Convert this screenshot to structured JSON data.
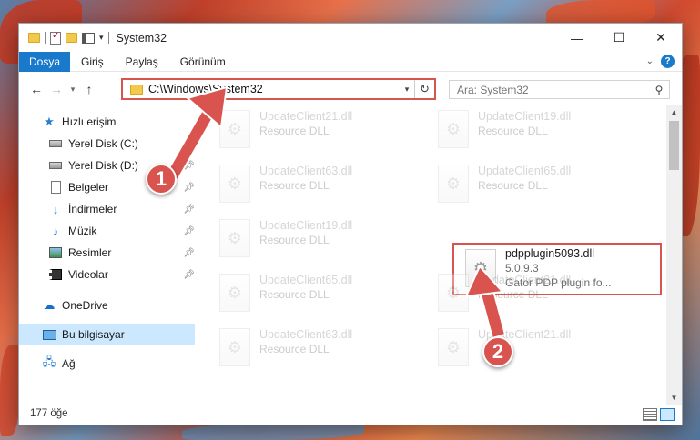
{
  "window": {
    "title": "System32",
    "controls": {
      "minimize": "—",
      "maximize": "☐",
      "close": "✕"
    }
  },
  "ribbon": {
    "file_tab": "Dosya",
    "tabs": [
      "Giriş",
      "Paylaş",
      "Görünüm"
    ],
    "help": "?"
  },
  "nav": {
    "address": "C:\\Windows\\System32",
    "search_placeholder": "Ara: System32"
  },
  "sidebar": {
    "quick_access": "Hızlı erişim",
    "items": [
      {
        "label": "Yerel Disk (C:)",
        "icon": "drive-icon"
      },
      {
        "label": "Yerel Disk (D:)",
        "icon": "drive-icon"
      },
      {
        "label": "Belgeler",
        "icon": "documents-icon"
      },
      {
        "label": "İndirmeler",
        "icon": "downloads-icon"
      },
      {
        "label": "Müzik",
        "icon": "music-icon"
      },
      {
        "label": "Resimler",
        "icon": "pictures-icon"
      },
      {
        "label": "Videolar",
        "icon": "videos-icon"
      }
    ],
    "onedrive": "OneDrive",
    "this_pc": "Bu bilgisayar",
    "network": "Ağ"
  },
  "files": [
    {
      "name": "UpdateClient21.dll",
      "desc": "Resource DLL"
    },
    {
      "name": "UpdateClient19.dll",
      "desc": "Resource DLL"
    },
    {
      "name": "UpdateClient63.dll",
      "desc": "Resource DLL"
    },
    {
      "name": "UpdateClient65.dll",
      "desc": "Resource DLL"
    },
    {
      "name": "UpdateClient19.dll",
      "desc": "Resource DLL"
    },
    {
      "name": "pdpplugin5093.dll",
      "version": "5.0.9.3",
      "desc": "Gator PDP plugin fo..."
    },
    {
      "name": "UpdateClient65.dll",
      "desc": "Resource DLL"
    },
    {
      "name": "UpdateClient21.dll",
      "desc": "Resource DLL"
    },
    {
      "name": "UpdateClient63.dll",
      "desc": "Resource DLL"
    },
    {
      "name": "UpdateClient21.dll",
      "desc": ""
    }
  ],
  "status": {
    "count": "177 öğe"
  },
  "annotations": {
    "badge1": "1",
    "badge2": "2",
    "color": "#d9534f"
  }
}
